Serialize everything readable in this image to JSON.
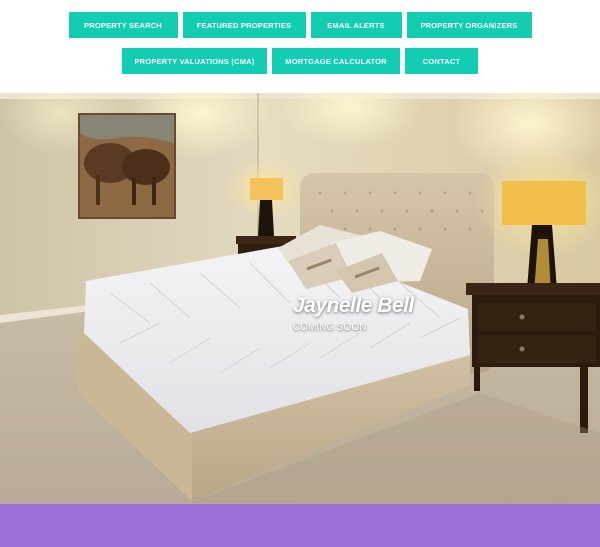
{
  "nav": {
    "row1": [
      {
        "label": "PROPERTY SEARCH"
      },
      {
        "label": "FEATURED PROPERTIES"
      },
      {
        "label": "EMAIL ALERTS"
      },
      {
        "label": "PROPERTY ORGANIZERS"
      }
    ],
    "row2": [
      {
        "label": "PROPERTY VALUATIONS (CMA)"
      },
      {
        "label": "MORTGAGE CALCULATOR"
      },
      {
        "label": "CONTACT"
      }
    ]
  },
  "hero": {
    "title": "Jaynelle Bell",
    "subtitle": "COMING SOON"
  },
  "colors": {
    "nav_button": "#13cdb3",
    "footer_band": "#9b6fd6"
  }
}
